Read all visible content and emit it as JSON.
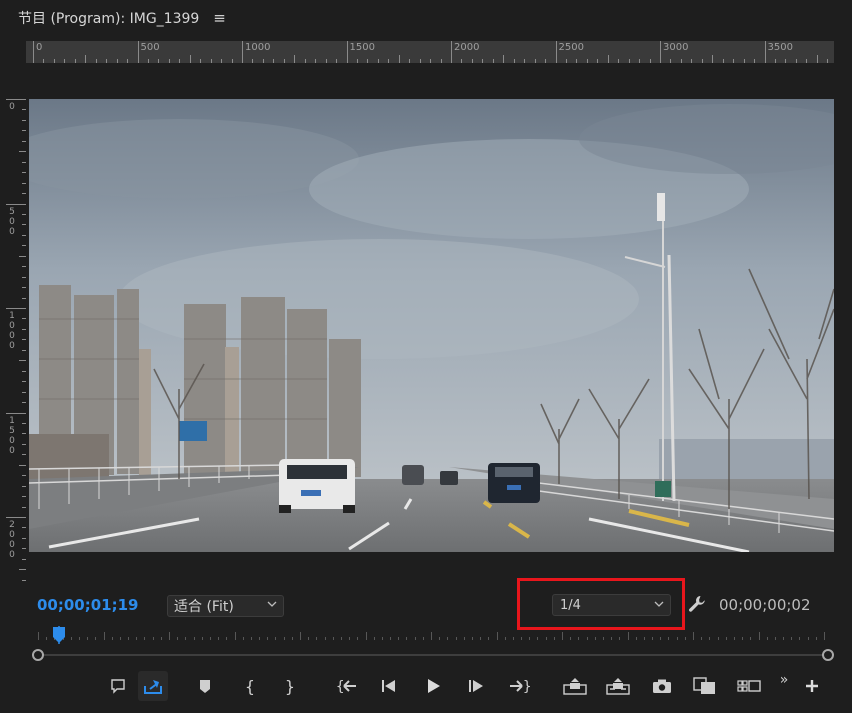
{
  "panel": {
    "title": "节目 (Program): IMG_1399",
    "menu_icon": "hamburger-icon"
  },
  "ruler_horizontal": [
    "0",
    "500",
    "1000",
    "1500",
    "2000",
    "2500",
    "3000",
    "3500"
  ],
  "ruler_vertical": [
    "0",
    "500",
    "1000",
    "1500",
    "2000"
  ],
  "playback": {
    "current_timecode": "00;00;01;19",
    "duration_timecode": "00;00;00;02",
    "zoom_select": {
      "value": "适合 (Fit)"
    },
    "resolution_select": {
      "value": "1/4"
    }
  },
  "colors": {
    "accent": "#2d8ceb",
    "highlight": "#e8161c",
    "panel_bg": "#1e1e1e",
    "ruler_bg": "#3a3a3a"
  },
  "toolbar": {
    "buttons": [
      "comment-icon",
      "export-frame-icon",
      "add-marker-icon",
      "mark-in-icon",
      "mark-out-icon",
      "go-to-in-icon",
      "step-back-icon",
      "play-icon",
      "step-forward-icon",
      "go-to-out-icon",
      "lift-icon",
      "extract-icon",
      "camera-icon",
      "comparison-view-icon",
      "multi-camera-icon",
      "more-icon",
      "add-button-icon"
    ]
  }
}
